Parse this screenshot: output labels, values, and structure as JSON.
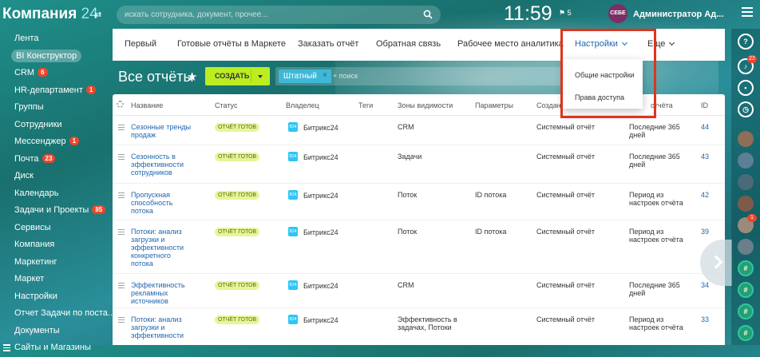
{
  "header": {
    "logo_name": "Компания",
    "logo_number": "24",
    "search_placeholder": "искать сотрудника, документ, прочее...",
    "clock": "11:59",
    "flag_count": "5",
    "user_avatar_text": "СЕБЕ",
    "user_name": "Администратор Ад..."
  },
  "left_menu": [
    {
      "label": "Лента"
    },
    {
      "label": "BI Конструктор",
      "active": true
    },
    {
      "label": "CRM",
      "badge": "6"
    },
    {
      "label": "HR-департамент",
      "badge": "1"
    },
    {
      "label": "Группы"
    },
    {
      "label": "Сотрудники"
    },
    {
      "label": "Мессенджер",
      "badge": "1"
    },
    {
      "label": "Почта",
      "badge": "23"
    },
    {
      "label": "Диск"
    },
    {
      "label": "Календарь"
    },
    {
      "label": "Задачи и Проекты",
      "badge": "85"
    },
    {
      "label": "Сервисы"
    },
    {
      "label": "Компания"
    },
    {
      "label": "Маркетинг"
    },
    {
      "label": "Маркет"
    },
    {
      "label": "Настройки"
    },
    {
      "label": "Отчет Задачи по поста..."
    },
    {
      "label": "Документы"
    },
    {
      "label": "Сайты и Магазины"
    }
  ],
  "tabs": [
    {
      "label": "Первый"
    },
    {
      "label": "Готовые отчёты в Маркете"
    },
    {
      "label": "Заказать отчёт"
    },
    {
      "label": "Обратная связь"
    },
    {
      "label": "Рабочее место аналитика"
    },
    {
      "label": "Настройки"
    },
    {
      "label": "Еще"
    }
  ],
  "toolbar": {
    "page_title": "Все отчёты",
    "create_label": "создать",
    "filter_tag": "Штатный",
    "filter_placeholder": "+ поиск"
  },
  "dropdown": {
    "items": [
      "Общие настройки",
      "Права доступа"
    ]
  },
  "table": {
    "columns": [
      "Название",
      "Статус",
      "Владелец",
      "Теги",
      "Зоны видимости",
      "Параметры",
      "Создан",
      "Период отчёта",
      "ID"
    ],
    "column_fragments": {
      "created": "Создан",
      "period": "отчёта"
    },
    "rows": [
      {
        "name": "Сезонные тренды продаж",
        "status": "ОТЧЁТ ГОТОВ",
        "owner": "Битрикс24",
        "zones": "CRM",
        "params": "",
        "created": "Системный отчёт",
        "period": "Последние 365 дней",
        "id": "44"
      },
      {
        "name": "Сезонность в эффективности сотрудников",
        "status": "ОТЧЁТ ГОТОВ",
        "owner": "Битрикс24",
        "zones": "Задачи",
        "params": "",
        "created": "Системный отчёт",
        "period": "Последние 365 дней",
        "id": "43"
      },
      {
        "name": "Пропускная способность потока",
        "status": "ОТЧЁТ ГОТОВ",
        "owner": "Битрикс24",
        "zones": "Поток",
        "params": "ID потока",
        "created": "Системный отчёт",
        "period": "Период из настроек отчёта",
        "id": "42"
      },
      {
        "name": "Потоки: анализ загрузки и эффективности конкретного потока",
        "status": "ОТЧЁТ ГОТОВ",
        "owner": "Битрикс24",
        "zones": "Поток",
        "params": "ID потока",
        "created": "Системный отчёт",
        "period": "Период из настроек отчёта",
        "id": "39"
      },
      {
        "name": "Эффективность рекламных источников",
        "status": "ОТЧЁТ ГОТОВ",
        "owner": "Битрикс24",
        "zones": "CRM",
        "params": "",
        "created": "Системный отчёт",
        "period": "Последние 365 дней",
        "id": "34"
      },
      {
        "name": "Потоки: анализ загрузки и эффективности",
        "status": "ОТЧЁТ ГОТОВ",
        "owner": "Битрикс24",
        "zones": "Эффективность в задачах, Потоки",
        "params": "",
        "created": "Системный отчёт",
        "period": "Период из настроек отчёта",
        "id": "33"
      }
    ]
  },
  "right_panel": {
    "help_label": "?",
    "badges": [
      "22",
      "1"
    ]
  },
  "colors": {
    "accent": "#2067b0",
    "create_button": "#bbed21",
    "badge": "#f0452a",
    "highlight": "#e0341c"
  }
}
